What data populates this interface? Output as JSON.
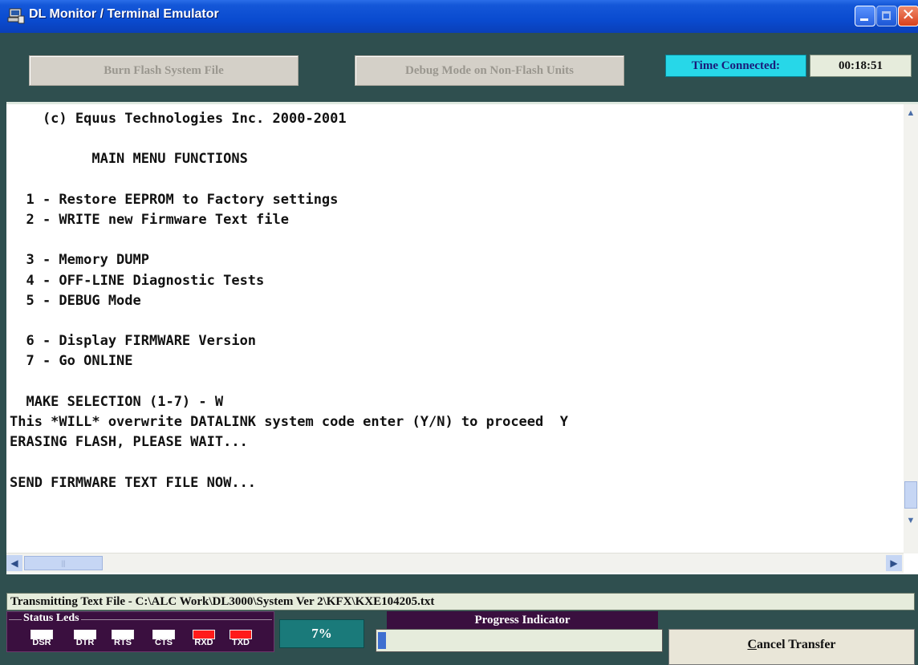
{
  "window": {
    "title": "DL Monitor / Terminal Emulator"
  },
  "toolbar": {
    "burn_label": "Burn Flash System File",
    "debug_label": "Debug Mode on Non-Flash Units",
    "time_connected_label": "Time Connected:",
    "time_connected_value": "00:18:51"
  },
  "terminal": {
    "lines": [
      "    (c) Equus Technologies Inc. 2000-2001",
      "",
      "          MAIN MENU FUNCTIONS",
      "",
      "  1 - Restore EEPROM to Factory settings",
      "  2 - WRITE new Firmware Text file",
      "",
      "  3 - Memory DUMP",
      "  4 - OFF-LINE Diagnostic Tests",
      "  5 - DEBUG Mode",
      "",
      "  6 - Display FIRMWARE Version",
      "  7 - Go ONLINE",
      "",
      "  MAKE SELECTION (1-7) - W",
      "This *WILL* overwrite DATALINK system code enter (Y/N) to proceed  Y",
      "ERASING FLASH, PLEASE WAIT...",
      "",
      "SEND FIRMWARE TEXT FILE NOW..."
    ]
  },
  "status": {
    "transmit_text": "Transmitting Text File - C:\\ALC Work\\DL3000\\System Ver 2\\KFX\\KXE104205.txt",
    "leds_label": "Status Leds",
    "leds": [
      {
        "label": "DSR",
        "state": "off"
      },
      {
        "label": "DTR",
        "state": "off"
      },
      {
        "label": "RTS",
        "state": "off"
      },
      {
        "label": "CTS",
        "state": "off"
      },
      {
        "label": "RXD",
        "state": "on"
      },
      {
        "label": "TXD",
        "state": "on"
      }
    ],
    "percent_text": "7%",
    "progress_title": "Progress Indicator",
    "progress_fraction": 0.07,
    "cancel_prefix": "C",
    "cancel_rest": "ancel Transfer"
  },
  "colors": {
    "frame": "#2f4f4f",
    "led_on": "#ff1a1a",
    "led_off": "#ffffff",
    "progress_fill": "#3e6fd0",
    "time_label_bg": "#27d7e8"
  }
}
